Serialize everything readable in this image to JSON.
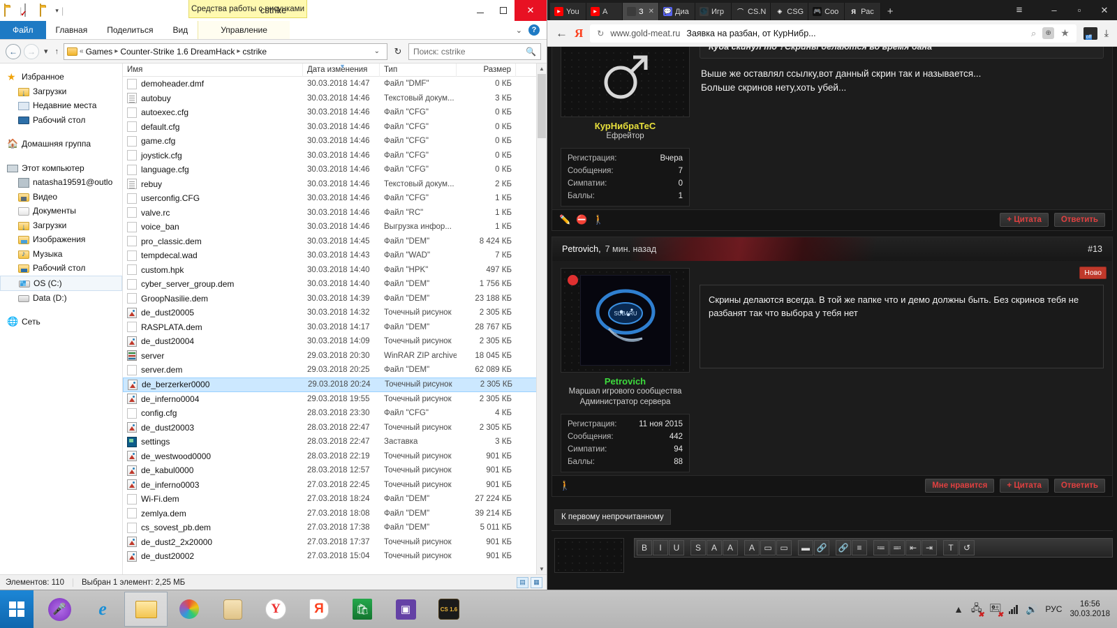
{
  "explorer": {
    "title": "cstrike",
    "contextual_tab": "Средства работы с рисунками",
    "ribbon_tabs": [
      "Файл",
      "Главная",
      "Поделиться",
      "Вид",
      "Управление"
    ],
    "breadcrumb": [
      "Games",
      "Counter-Strike 1.6 DreamHack",
      "cstrike"
    ],
    "search_placeholder": "Поиск: cstrike",
    "window_buttons": {
      "minimize": "–",
      "maximize": "▫",
      "close": "✕"
    },
    "sidebar": [
      {
        "label": "Избранное",
        "icon": "star-icon",
        "level": 0
      },
      {
        "label": "Загрузки",
        "icon": "downloads-icon",
        "level": 1
      },
      {
        "label": "Недавние места",
        "icon": "recent-places-icon",
        "level": 1
      },
      {
        "label": "Рабочий стол",
        "icon": "desktop-icon",
        "level": 1
      },
      {
        "label": "Домашняя группа",
        "icon": "homegroup-icon",
        "level": 0
      },
      {
        "label": "Этот компьютер",
        "icon": "this-pc-icon",
        "level": 0
      },
      {
        "label": "natasha19591@outlo",
        "icon": "account-icon",
        "level": 1
      },
      {
        "label": "Видео",
        "icon": "video-folder-icon",
        "level": 1
      },
      {
        "label": "Документы",
        "icon": "documents-folder-icon",
        "level": 1
      },
      {
        "label": "Загрузки",
        "icon": "downloads-folder-icon",
        "level": 1
      },
      {
        "label": "Изображения",
        "icon": "pictures-folder-icon",
        "level": 1
      },
      {
        "label": "Музыка",
        "icon": "music-folder-icon",
        "level": 1
      },
      {
        "label": "Рабочий стол",
        "icon": "desktop-folder-icon",
        "level": 1
      },
      {
        "label": "OS (C:)",
        "icon": "os-drive-icon",
        "level": 1,
        "selected": true
      },
      {
        "label": "Data (D:)",
        "icon": "data-drive-icon",
        "level": 1
      },
      {
        "label": "Сеть",
        "icon": "network-icon",
        "level": 0
      }
    ],
    "columns": [
      "Имя",
      "Дата изменения",
      "Тип",
      "Размер"
    ],
    "files": [
      {
        "name": "demoheader.dmf",
        "date": "30.03.2018 14:47",
        "type": "Файл \"DMF\"",
        "size": "0 КБ",
        "icon": "blank-file-icon"
      },
      {
        "name": "autobuy",
        "date": "30.03.2018 14:46",
        "type": "Текстовый докум...",
        "size": "3 КБ",
        "icon": "text-file-icon"
      },
      {
        "name": "autoexec.cfg",
        "date": "30.03.2018 14:46",
        "type": "Файл \"CFG\"",
        "size": "0 КБ",
        "icon": "blank-file-icon"
      },
      {
        "name": "default.cfg",
        "date": "30.03.2018 14:46",
        "type": "Файл \"CFG\"",
        "size": "0 КБ",
        "icon": "blank-file-icon"
      },
      {
        "name": "game.cfg",
        "date": "30.03.2018 14:46",
        "type": "Файл \"CFG\"",
        "size": "0 КБ",
        "icon": "blank-file-icon"
      },
      {
        "name": "joystick.cfg",
        "date": "30.03.2018 14:46",
        "type": "Файл \"CFG\"",
        "size": "0 КБ",
        "icon": "blank-file-icon"
      },
      {
        "name": "language.cfg",
        "date": "30.03.2018 14:46",
        "type": "Файл \"CFG\"",
        "size": "0 КБ",
        "icon": "blank-file-icon"
      },
      {
        "name": "rebuy",
        "date": "30.03.2018 14:46",
        "type": "Текстовый докум...",
        "size": "2 КБ",
        "icon": "text-file-icon"
      },
      {
        "name": "userconfig.CFG",
        "date": "30.03.2018 14:46",
        "type": "Файл \"CFG\"",
        "size": "1 КБ",
        "icon": "blank-file-icon"
      },
      {
        "name": "valve.rc",
        "date": "30.03.2018 14:46",
        "type": "Файл \"RC\"",
        "size": "1 КБ",
        "icon": "blank-file-icon"
      },
      {
        "name": "voice_ban",
        "date": "30.03.2018 14:46",
        "type": "Выгрузка инфор...",
        "size": "1 КБ",
        "icon": "blank-file-icon"
      },
      {
        "name": "pro_classic.dem",
        "date": "30.03.2018 14:45",
        "type": "Файл \"DEM\"",
        "size": "8 424 КБ",
        "icon": "blank-file-icon"
      },
      {
        "name": "tempdecal.wad",
        "date": "30.03.2018 14:43",
        "type": "Файл \"WAD\"",
        "size": "7 КБ",
        "icon": "blank-file-icon"
      },
      {
        "name": "custom.hpk",
        "date": "30.03.2018 14:40",
        "type": "Файл \"HPK\"",
        "size": "497 КБ",
        "icon": "blank-file-icon"
      },
      {
        "name": "cyber_server_group.dem",
        "date": "30.03.2018 14:40",
        "type": "Файл \"DEM\"",
        "size": "1 756 КБ",
        "icon": "blank-file-icon"
      },
      {
        "name": "GroopNasilie.dem",
        "date": "30.03.2018 14:39",
        "type": "Файл \"DEM\"",
        "size": "23 188 КБ",
        "icon": "blank-file-icon"
      },
      {
        "name": "de_dust20005",
        "date": "30.03.2018 14:32",
        "type": "Точечный рисунок",
        "size": "2 305 КБ",
        "icon": "bitmap-icon"
      },
      {
        "name": "RASPLATA.dem",
        "date": "30.03.2018 14:17",
        "type": "Файл \"DEM\"",
        "size": "28 767 КБ",
        "icon": "blank-file-icon"
      },
      {
        "name": "de_dust20004",
        "date": "30.03.2018 14:09",
        "type": "Точечный рисунок",
        "size": "2 305 КБ",
        "icon": "bitmap-icon"
      },
      {
        "name": "server",
        "date": "29.03.2018 20:30",
        "type": "WinRAR ZIP archive",
        "size": "18 045 КБ",
        "icon": "zip-icon"
      },
      {
        "name": "server.dem",
        "date": "29.03.2018 20:25",
        "type": "Файл \"DEM\"",
        "size": "62 089 КБ",
        "icon": "blank-file-icon"
      },
      {
        "name": "de_berzerker0000",
        "date": "29.03.2018 20:24",
        "type": "Точечный рисунок",
        "size": "2 305 КБ",
        "icon": "bitmap-icon",
        "selected": true
      },
      {
        "name": "de_inferno0004",
        "date": "29.03.2018 19:55",
        "type": "Точечный рисунок",
        "size": "2 305 КБ",
        "icon": "bitmap-icon"
      },
      {
        "name": "config.cfg",
        "date": "28.03.2018 23:30",
        "type": "Файл \"CFG\"",
        "size": "4 КБ",
        "icon": "blank-file-icon"
      },
      {
        "name": "de_dust20003",
        "date": "28.03.2018 22:47",
        "type": "Точечный рисунок",
        "size": "2 305 КБ",
        "icon": "bitmap-icon"
      },
      {
        "name": "settings",
        "date": "28.03.2018 22:47",
        "type": "Заставка",
        "size": "3 КБ",
        "icon": "screensaver-icon"
      },
      {
        "name": "de_westwood0000",
        "date": "28.03.2018 22:19",
        "type": "Точечный рисунок",
        "size": "901 КБ",
        "icon": "bitmap-icon"
      },
      {
        "name": "de_kabul0000",
        "date": "28.03.2018 12:57",
        "type": "Точечный рисунок",
        "size": "901 КБ",
        "icon": "bitmap-icon"
      },
      {
        "name": "de_inferno0003",
        "date": "27.03.2018 22:45",
        "type": "Точечный рисунок",
        "size": "901 КБ",
        "icon": "bitmap-icon"
      },
      {
        "name": "Wi-Fi.dem",
        "date": "27.03.2018 18:24",
        "type": "Файл \"DEM\"",
        "size": "27 224 КБ",
        "icon": "blank-file-icon"
      },
      {
        "name": "zemlya.dem",
        "date": "27.03.2018 18:08",
        "type": "Файл \"DEM\"",
        "size": "39 214 КБ",
        "icon": "blank-file-icon"
      },
      {
        "name": "cs_sovest_pb.dem",
        "date": "27.03.2018 17:38",
        "type": "Файл \"DEM\"",
        "size": "5 011 КБ",
        "icon": "blank-file-icon"
      },
      {
        "name": "de_dust2_2x20000",
        "date": "27.03.2018 17:37",
        "type": "Точечный рисунок",
        "size": "901 КБ",
        "icon": "bitmap-icon"
      },
      {
        "name": "de_dust20002",
        "date": "27.03.2018 15:04",
        "type": "Точечный рисунок",
        "size": "901 КБ",
        "icon": "bitmap-icon"
      }
    ],
    "status": {
      "count": "Элементов: 110",
      "selection": "Выбран 1 элемент: 2,25 МБ"
    }
  },
  "browser": {
    "tabs": [
      {
        "label": "You",
        "icon": "youtube-icon",
        "active": false
      },
      {
        "label": "А",
        "icon": "youtube-icon",
        "active": false
      },
      {
        "label": "З",
        "icon": "page-icon",
        "active": true,
        "close": "✕"
      },
      {
        "label": "Диа",
        "icon": "discord-icon",
        "active": false
      },
      {
        "label": "Игр",
        "icon": "globe-icon",
        "active": false
      },
      {
        "label": "CS.N",
        "icon": "cs-icon",
        "active": false
      },
      {
        "label": "CSG",
        "icon": "csgo-icon",
        "active": false
      },
      {
        "label": "Соо",
        "icon": "community-icon",
        "active": false
      },
      {
        "label": "Рас",
        "icon": "yandex-icon",
        "active": false
      }
    ],
    "new_tab": "+",
    "window_controls": {
      "menu": "≡",
      "minimize": "–",
      "maximize": "▫",
      "close": "✕"
    },
    "address": {
      "back": "←",
      "brand": "Я",
      "reload": "↻",
      "host": "www.gold-meat.ru",
      "page_title": "Заявка на разбан, от КурНибр...",
      "zoom_icon": "zoom-icon",
      "translate_icon": "translate-icon",
      "bookmark_icon": "star-icon",
      "extension_badge": "off",
      "download_icon": "download-icon"
    }
  },
  "forum": {
    "post_top": {
      "quote": "Куда скинул то ?Скрины делаются во время бана",
      "body_lines": [
        "Выше же оставлял ссылку,вот данный скрин так и называется...",
        "Больше скринов нету,хоть убей..."
      ],
      "user": {
        "name": "КурНибраТеС",
        "name_color": "#e8e03c",
        "title": "Ефрейтор",
        "stats": [
          {
            "label": "Регистрация:",
            "value": "Вчера"
          },
          {
            "label": "Сообщения:",
            "value": "7"
          },
          {
            "label": "Симпатии:",
            "value": "0"
          },
          {
            "label": "Баллы:",
            "value": "1"
          }
        ]
      },
      "footer_icons": [
        "edit-icon",
        "report-icon",
        "warn-icon"
      ],
      "buttons": [
        "+ Цитата",
        "Ответить"
      ]
    },
    "post_bottom": {
      "header_user": "Petrovich,",
      "header_time": "7 мин. назад",
      "post_number": "#13",
      "new_badge": "Ново",
      "message": "Скрины делаются всегда. В той же папке что и демо должны быть. Без скринов тебя не разбанят так что выбора у тебя нет",
      "user": {
        "name": "Petrovich",
        "name_color": "#3ddb3d",
        "title_line1": "Маршал игрового сообщества",
        "title_line2": "Администратор сервера",
        "avatar_label": "SUBARU",
        "stats": [
          {
            "label": "Регистрация:",
            "value": "11 ноя 2015"
          },
          {
            "label": "Сообщения:",
            "value": "442"
          },
          {
            "label": "Симпатии:",
            "value": "94"
          },
          {
            "label": "Баллы:",
            "value": "88"
          }
        ]
      },
      "footer_icons": [
        "warn-icon"
      ],
      "buttons": [
        "Мне нравится",
        "+ Цитата",
        "Ответить"
      ]
    },
    "unread_button": "К первому непрочитанному",
    "editor_toolbar": [
      "B",
      "I",
      "U",
      "S",
      "A",
      "A",
      "A",
      "▭",
      "▭",
      "▬",
      "🔗",
      "🔗",
      "≡",
      "≔",
      "≕",
      "⇤",
      "⇥",
      "T",
      "↺"
    ]
  },
  "taskbar": {
    "start": "windows-logo",
    "items": [
      {
        "icon": "cortana-icon",
        "name": "cortana"
      },
      {
        "icon": "internet-explorer-icon",
        "name": "internet-explorer"
      },
      {
        "icon": "file-explorer-icon",
        "name": "file-explorer",
        "active": true
      },
      {
        "icon": "photo-viewer-icon",
        "name": "photos"
      },
      {
        "icon": "notes-icon",
        "name": "notes"
      },
      {
        "icon": "yandex-browser-icon",
        "name": "yandex-browser"
      },
      {
        "icon": "yandex-icon",
        "name": "yandex"
      },
      {
        "icon": "store-icon",
        "name": "store"
      },
      {
        "icon": "twitch-icon",
        "name": "twitch"
      },
      {
        "icon": "counter-strike-icon",
        "name": "counter-strike",
        "label": "CS 1.6"
      }
    ],
    "tray": {
      "expand": "▲",
      "network_icon": "network-error-icon",
      "usb_icon": "usb-error-icon",
      "signal_icon": "signal-icon",
      "volume_icon": "volume-icon",
      "language": "РУС",
      "time": "16:56",
      "date": "30.03.2018"
    }
  }
}
